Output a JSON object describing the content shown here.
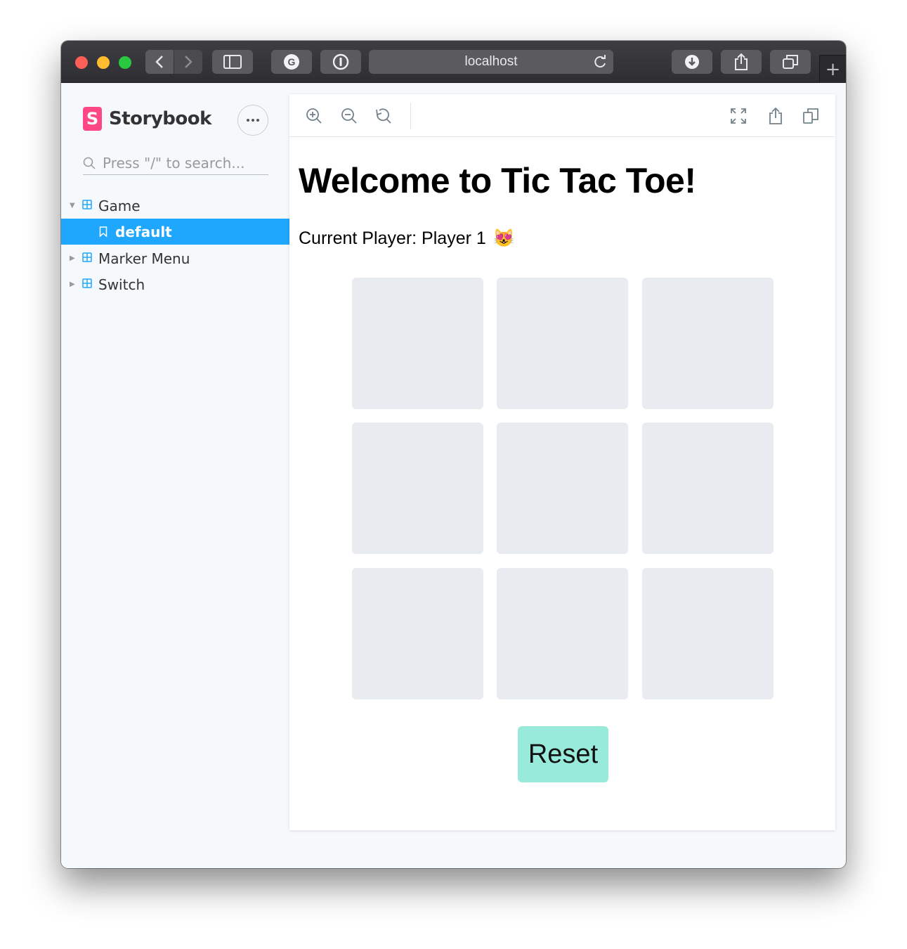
{
  "browser": {
    "url": "localhost"
  },
  "storybook": {
    "brand": "Storybook",
    "search_placeholder": "Press \"/\" to search...",
    "tree": [
      {
        "label": "Game",
        "expanded": true
      },
      {
        "label": "default",
        "selected": true
      },
      {
        "label": "Marker Menu",
        "expanded": false
      },
      {
        "label": "Switch",
        "expanded": false
      }
    ],
    "accent_color": "#1ea7fd",
    "brand_color": "#ff4785"
  },
  "game": {
    "title": "Welcome to Tic Tac Toe!",
    "current_player": "Current Player: Player 1",
    "player_emoji": "😻",
    "cells": [
      "",
      "",
      "",
      "",
      "",
      "",
      "",
      "",
      ""
    ],
    "reset_label": "Reset",
    "cell_color": "#e8ebef",
    "reset_color": "#98eadb"
  }
}
